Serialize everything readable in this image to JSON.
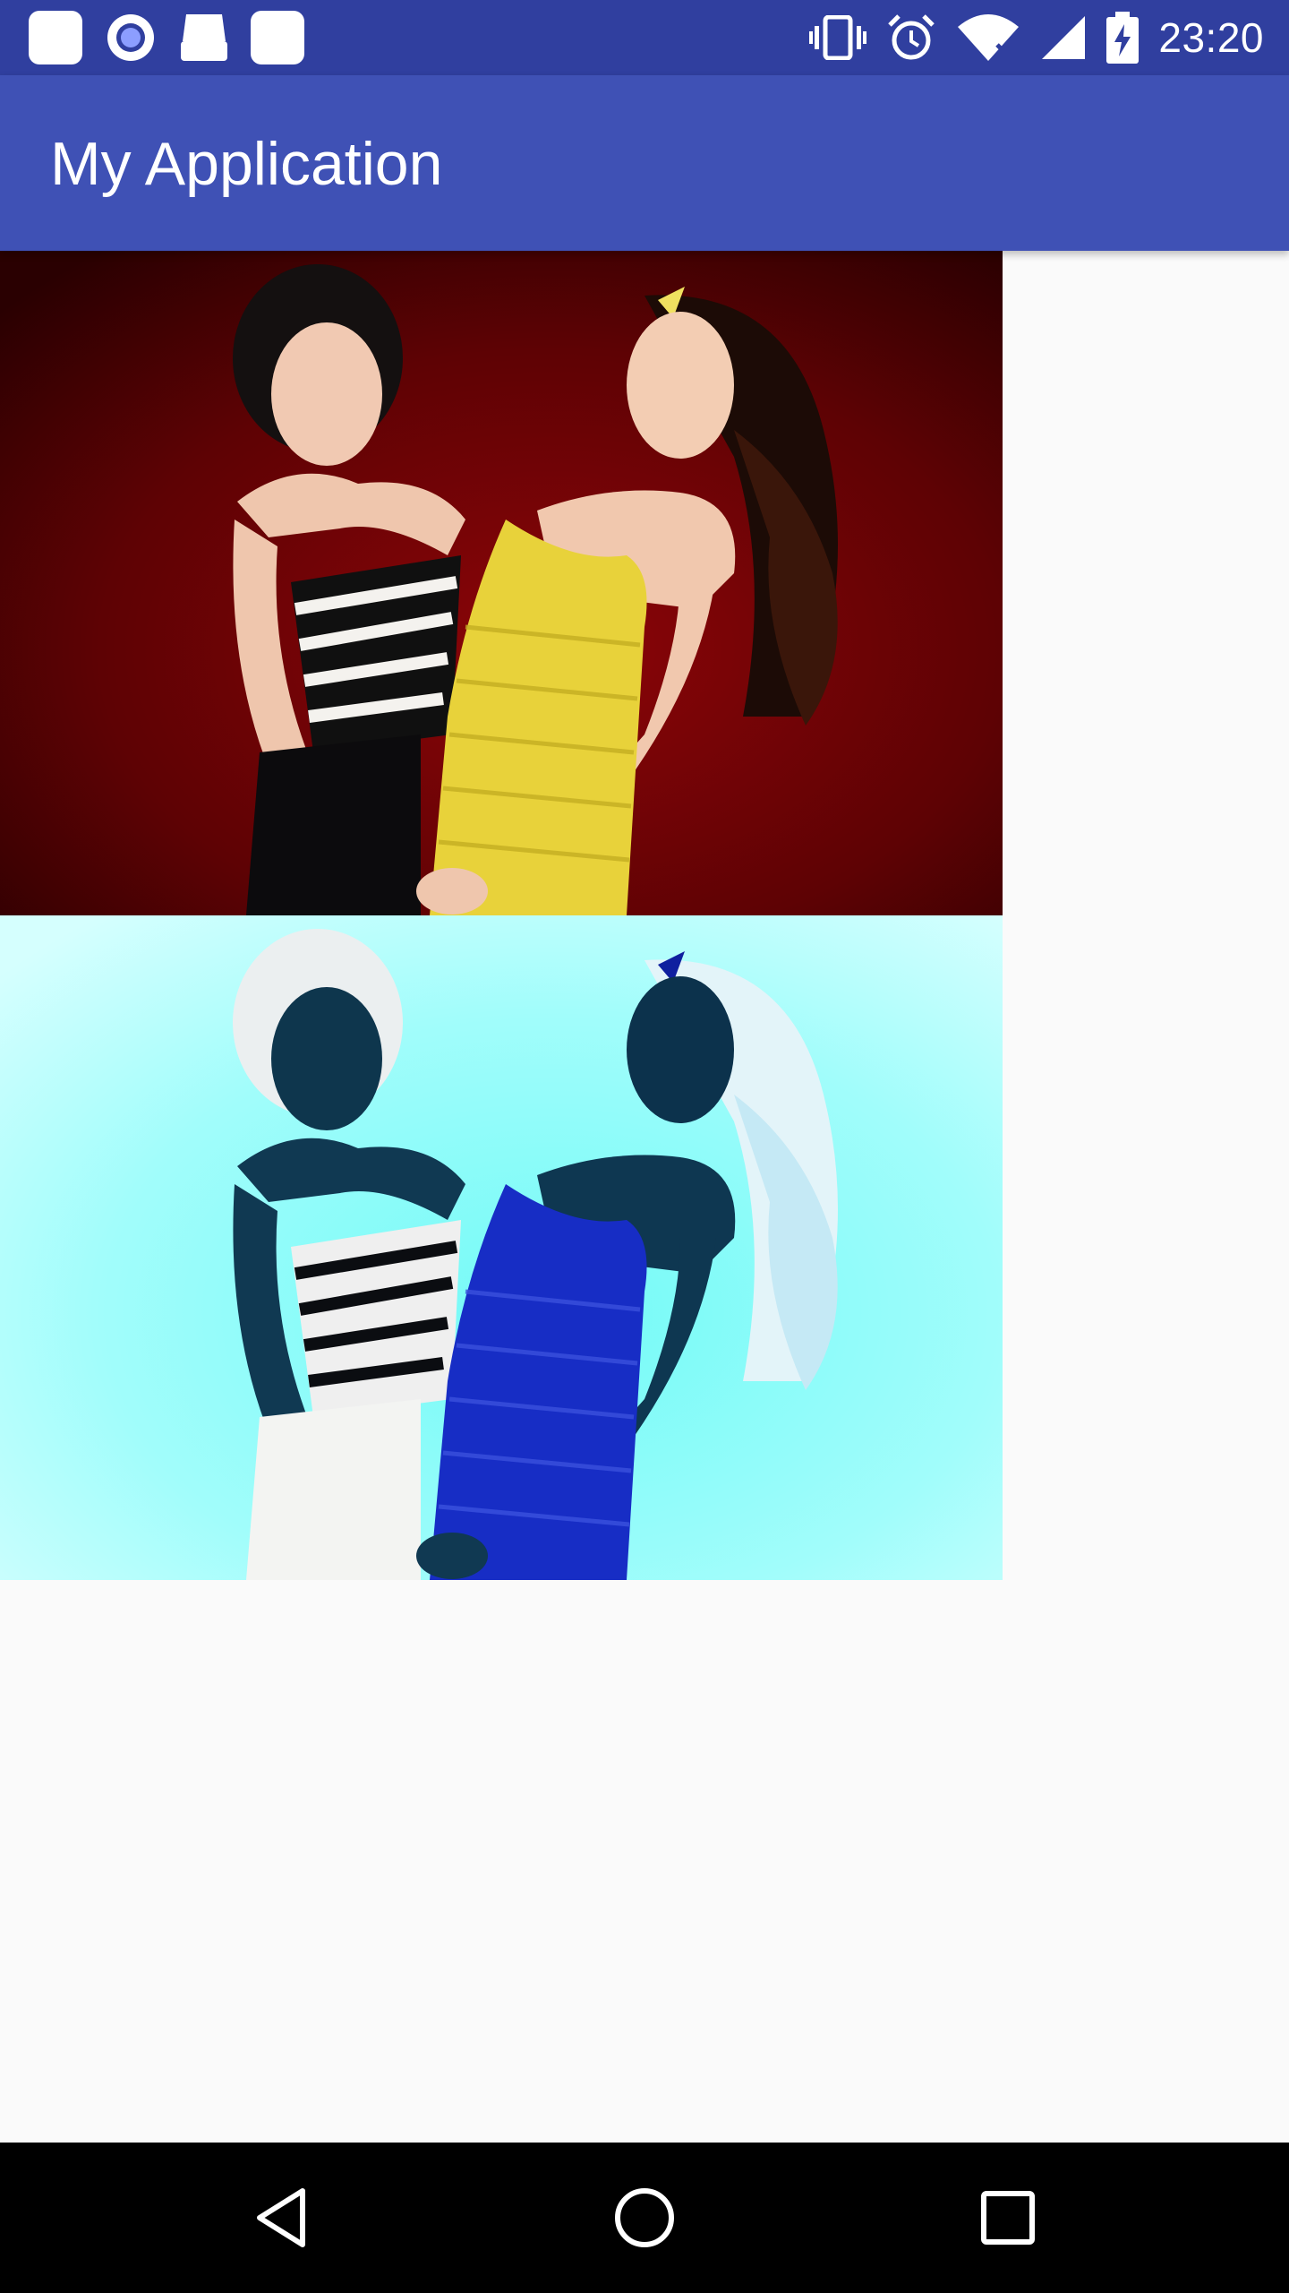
{
  "status_bar": {
    "time": "23:20",
    "left_icons": [
      "app-notification-icon",
      "record-icon",
      "android-debug-icon",
      "app-notification-icon"
    ],
    "right_icons": [
      "vibrate-icon",
      "alarm-icon",
      "wifi-no-internet-icon",
      "cell-signal-icon",
      "battery-charging-icon"
    ]
  },
  "app_bar": {
    "title": "My Application"
  },
  "images": [
    {
      "name": "original-photo",
      "variant": "original"
    },
    {
      "name": "inverted-photo",
      "variant": "color-inverted"
    }
  ],
  "nav_bar": {
    "buttons": [
      "back",
      "home",
      "recents"
    ]
  },
  "colors": {
    "status_bar": "#303f9f",
    "app_bar": "#3f51b5",
    "background": "#fafafa",
    "nav_bar": "#000000"
  }
}
